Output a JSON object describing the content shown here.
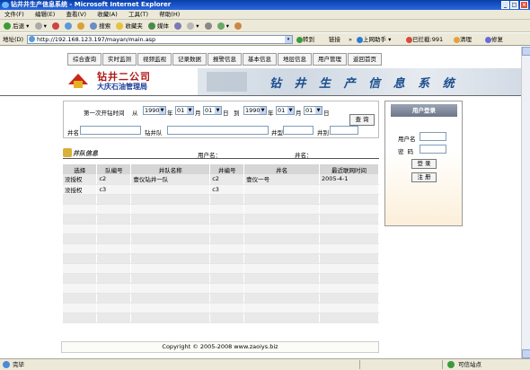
{
  "window": {
    "title": "钻井井生产信息系统 - Microsoft Internet Explorer",
    "controls": [
      "_",
      "□",
      "×"
    ]
  },
  "menu": [
    "文件(F)",
    "编辑(E)",
    "查看(V)",
    "收藏(A)",
    "工具(T)",
    "帮助(H)"
  ],
  "toolbar": {
    "back": "后退",
    "search": "搜索",
    "favorites": "收藏夹",
    "media": "媒体"
  },
  "addressbar": {
    "label": "地址(D)",
    "url": "http://192.168.123.197/mayan/main.asp",
    "go": "转到",
    "links": "链接",
    "online_helper": "上网助手",
    "blocked": "已拦截:991",
    "clean": "清理",
    "repair": "修复"
  },
  "nav": [
    "综合查询",
    "实时监测",
    "视频监视",
    "记录数据",
    "报警信息",
    "基本信息",
    "地层信息",
    "用户管理",
    "返回首页"
  ],
  "logo": {
    "name": "钻井二公司",
    "sub": "大庆石油管理局"
  },
  "banner": {
    "title": "钻 井 生 产 信 息 系 统"
  },
  "search": {
    "first_spud_label": "第一次开钻时间",
    "from": "从",
    "to": "到",
    "year_unit": "年",
    "month_unit": "月",
    "day_unit": "日",
    "start": {
      "year": "1990",
      "month": "01",
      "day": "01"
    },
    "end": {
      "year": "1990",
      "month": "01",
      "day": "01"
    },
    "well_name_label": "井名",
    "crew_label": "钻井队",
    "well_type_label": "井型",
    "well_class_label": "井别",
    "query_button": "查 询"
  },
  "login": {
    "header": "用户登录",
    "username_label": "用户名",
    "password_label": "密  码",
    "login_button": "登 录",
    "register_button": "注 册"
  },
  "section": {
    "title": "井队信息",
    "user_label": "用户名：",
    "well_label": "井名："
  },
  "table": {
    "headers": [
      "选择",
      "队编号",
      "井队名称",
      "井编号",
      "井名",
      "最近联网时间"
    ],
    "rows": [
      [
        "没授权",
        "c2",
        "壹仪钻井一队",
        "c2",
        "壹仪一号",
        "2005-4-1"
      ],
      [
        "没授权",
        "c3",
        "",
        "c3",
        "",
        ""
      ]
    ]
  },
  "footer": {
    "text": "Copyright © 2005-2008 www.zaoiys.biz"
  },
  "statusbar": {
    "left": "完毕",
    "right": "可信站点"
  },
  "colors": {
    "titlebar": "#0a3fa8",
    "logo_red": "#b01818",
    "logo_blue": "#1a3c98",
    "table_header": "#d6d6d6"
  }
}
